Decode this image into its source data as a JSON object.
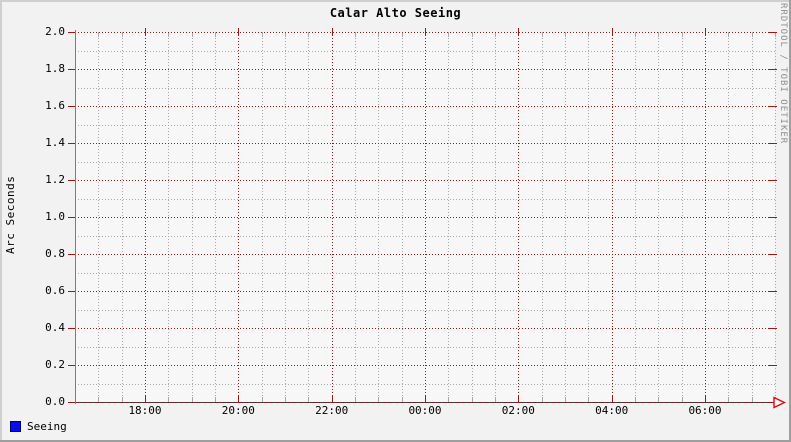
{
  "title": "Calar Alto Seeing",
  "watermark": "RRDTOOL / TOBI OETIKER",
  "legend": {
    "label": "Seeing",
    "color": "#0b0bf0",
    "border": "#000060"
  },
  "colors": {
    "background": "#f2f2f2",
    "canvas": "#f7f7f7",
    "border_light": "#cfcfcf",
    "border_dark": "#9e9e9e",
    "major_grid": "#9e1616",
    "minor_grid": "#a8a8a8",
    "y_axis_line": "#7d7d7d",
    "x_axis_line": "#3c3c3c",
    "arrow": "#dd0808",
    "watermark_text": "#8f8f8f",
    "text": "#000000"
  },
  "chart_data": {
    "type": "line",
    "title": "Calar Alto Seeing",
    "ylabel": "Arc Seconds",
    "xlabel": "",
    "ylim": [
      0.0,
      2.0
    ],
    "y_major_step": 0.2,
    "y_minor_step": 0.1,
    "y_tick_labels": [
      "2.0",
      "1.8",
      "1.6",
      "1.4",
      "1.2",
      "1.0",
      "0.8",
      "0.6",
      "0.4",
      "0.2",
      "0.0"
    ],
    "x_tick_labels": [
      "18:00",
      "20:00",
      "22:00",
      "00:00",
      "02:00",
      "04:00",
      "06:00"
    ],
    "x_minor_divisions_per_major": 4,
    "x_minor_total": 30,
    "x_first_major_minor_index": 3,
    "grid": true,
    "legend_position": "bottom-left",
    "series": [
      {
        "name": "Seeing",
        "color": "#0b0bf0",
        "values": []
      }
    ]
  }
}
